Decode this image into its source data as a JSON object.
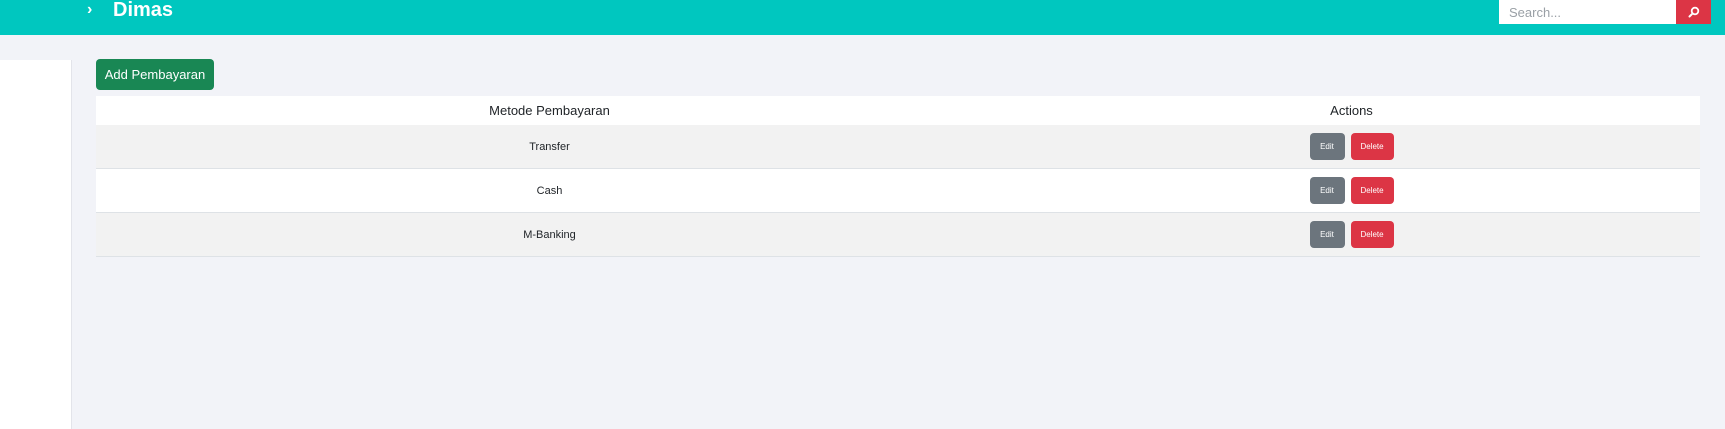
{
  "header": {
    "title": "Dimas",
    "search_placeholder": "Search...",
    "search_value": "",
    "background_color": "#00c7bf",
    "search_button_color": "#dc3545"
  },
  "main": {
    "add_button_label": "Add Pembayaran",
    "table": {
      "columns": [
        "Metode Pembayaran",
        "Actions"
      ],
      "rows": [
        {
          "method": "Transfer",
          "edit_label": "Edit",
          "delete_label": "Delete"
        },
        {
          "method": "Cash",
          "edit_label": "Edit",
          "delete_label": "Delete"
        },
        {
          "method": "M-Banking",
          "edit_label": "Edit",
          "delete_label": "Delete"
        }
      ]
    }
  },
  "icons": {
    "chevron": "chevron-right-icon",
    "search": "search-icon"
  }
}
